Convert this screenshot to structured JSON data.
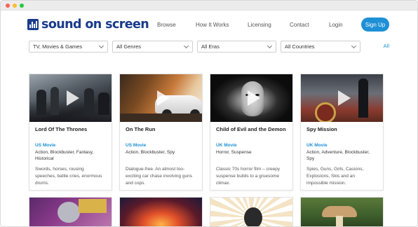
{
  "window": {
    "chrome_colors": [
      "#ff5f57",
      "#febc2e",
      "#28c840"
    ]
  },
  "brand": {
    "name": "sound on screen",
    "color": "#1a3b8c"
  },
  "nav": {
    "links": [
      "Browse",
      "How It Works",
      "Licensing",
      "Contact",
      "Login"
    ],
    "signup": "Sign Up",
    "accent": "#1e90d6"
  },
  "filters": {
    "category": "TV, Movies & Games",
    "genres": "All Genres",
    "eras": "All Eras",
    "countries": "All Countries",
    "all_link": "All"
  },
  "cards": [
    {
      "title": "Lord Of The Thrones",
      "origin": "US Movie",
      "genres": "Action, Blockbuster, Fantasy, Historical",
      "description": "Swords, horses, rousing speeches, battle cries, enormous drums.",
      "thumb_icon": "battle-scene-image"
    },
    {
      "title": "On The Run",
      "origin": "US Movie",
      "genres": "Action, Blockbuster, Spy",
      "description": "Dialogue-free. An almost too-exciting car chase involving guns and cops.",
      "thumb_icon": "car-chase-image"
    },
    {
      "title": "Child of Evil and the Demon",
      "origin": "UK Movie",
      "genres": "Horror, Suspense",
      "description": "Classic 70s horror film – creepy suspense builds to a gruesome climax.",
      "thumb_icon": "child-face-image"
    },
    {
      "title": "Spy Mission",
      "origin": "UK Movie",
      "genres": "Action, Adventure, Blockbuster, Spy",
      "description": "Spies, Guns, Girls, Casions, Explosions, Skis and an impossible mission.",
      "thumb_icon": "spy-casino-image"
    }
  ],
  "bottom_cards": [
    "cartoon-rat-image",
    "fire-figure-image",
    "comic-burst-image",
    "mushroom-forest-image"
  ]
}
